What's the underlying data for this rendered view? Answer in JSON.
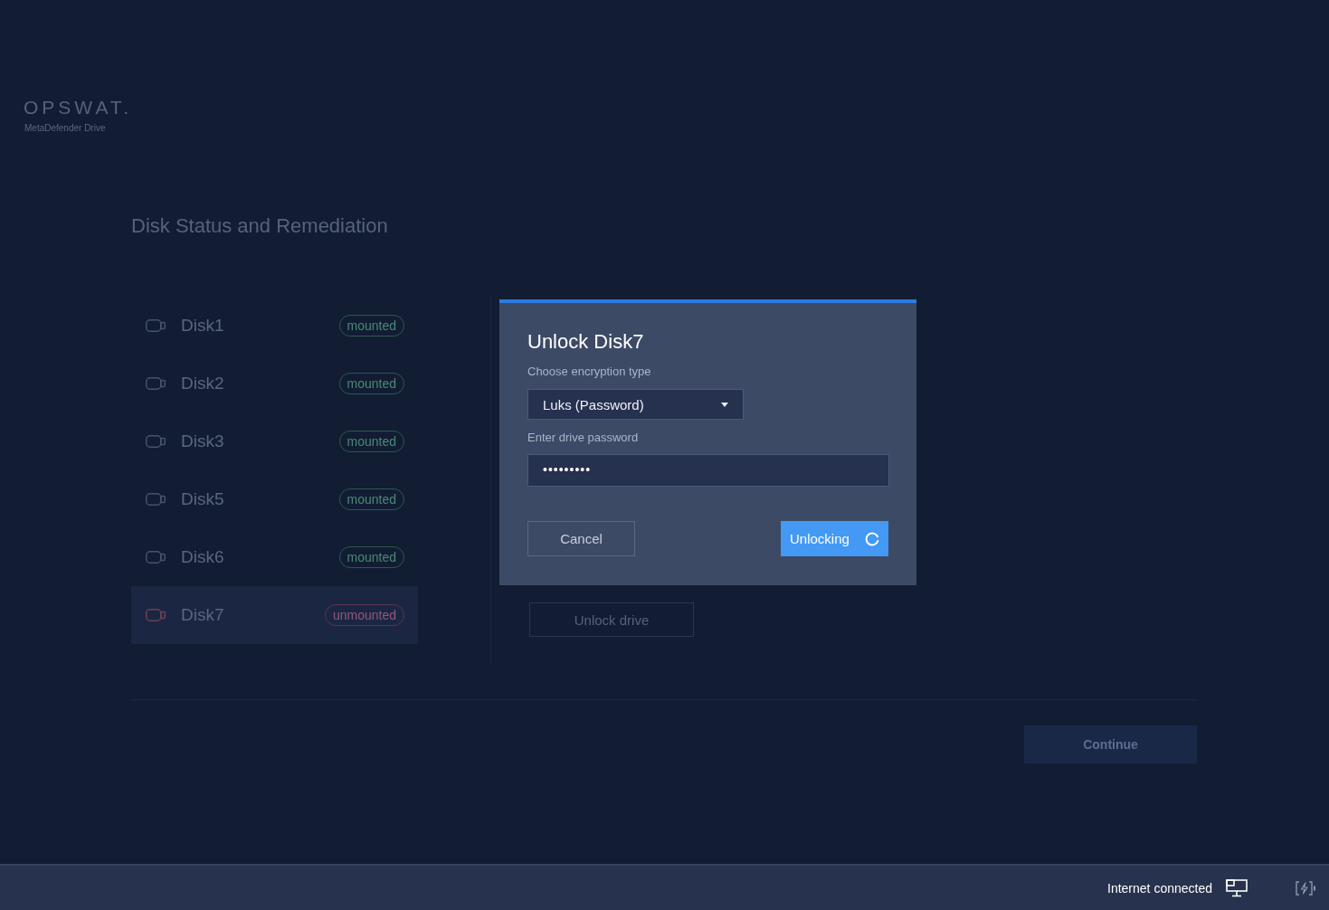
{
  "header": {
    "logo": "OPSWAT.",
    "product": "MetaDefender Drive"
  },
  "page": {
    "title": "Disk Status and Remediation"
  },
  "disks": [
    {
      "name": "Disk1",
      "status": "mounted",
      "kind": "mounted",
      "selected": false
    },
    {
      "name": "Disk2",
      "status": "mounted",
      "kind": "mounted",
      "selected": false
    },
    {
      "name": "Disk3",
      "status": "mounted",
      "kind": "mounted",
      "selected": false
    },
    {
      "name": "Disk5",
      "status": "mounted",
      "kind": "mounted",
      "selected": false
    },
    {
      "name": "Disk6",
      "status": "mounted",
      "kind": "mounted",
      "selected": false
    },
    {
      "name": "Disk7",
      "status": "unmounted",
      "kind": "unmounted",
      "selected": true
    }
  ],
  "detail": {
    "button": "Unlock drive"
  },
  "footer": {
    "button": "Continue"
  },
  "dialog": {
    "title": "Unlock Disk7",
    "encryption_label": "Choose encryption type",
    "encryption_value": "Luks (Password)",
    "password_label": "Enter drive password",
    "password_value": "•••••••••",
    "cancel": "Cancel",
    "confirm": {
      "label": "Unlocking",
      "busy": true
    }
  },
  "status_bar": {
    "internet": "Internet connected"
  }
}
